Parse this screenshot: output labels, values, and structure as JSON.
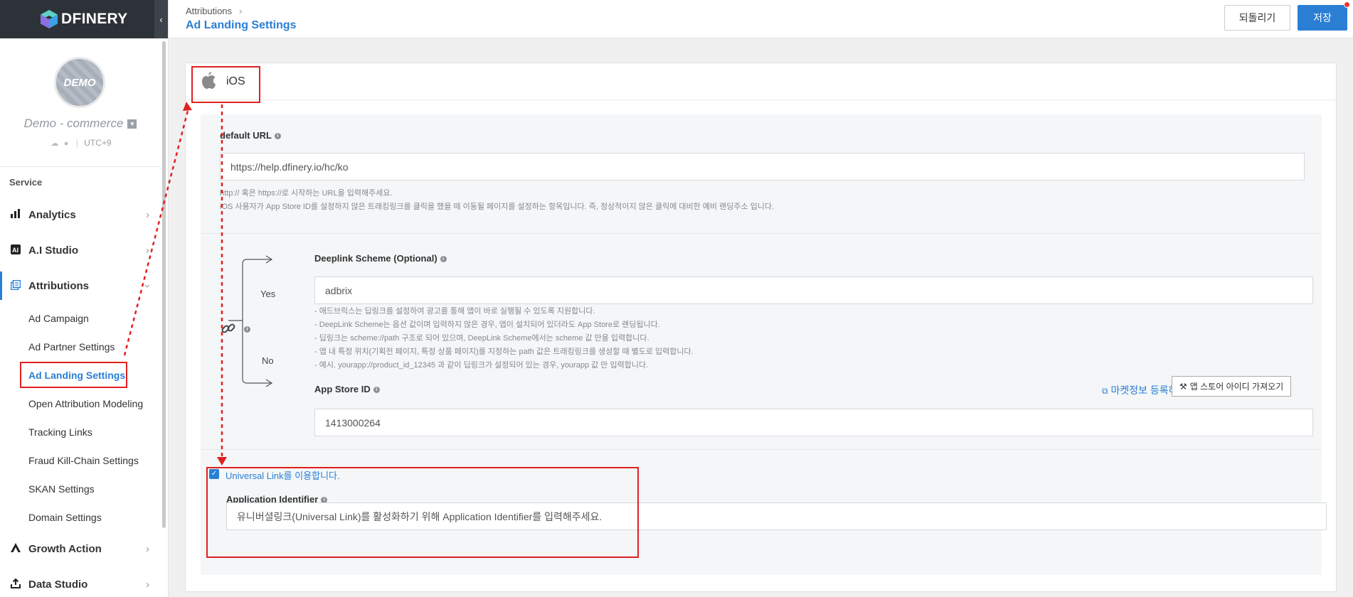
{
  "brand": {
    "name": "DFINERY"
  },
  "sidebar": {
    "collapse_icon": "‹",
    "profile": {
      "avatar_text": "DEMO",
      "company": "Demo - commerce",
      "timezone": "UTC+9"
    },
    "section_title": "Service",
    "items": [
      {
        "label": "Analytics",
        "icon": "bar-chart-icon"
      },
      {
        "label": "A.I Studio",
        "icon": "ai-icon"
      },
      {
        "label": "Attributions",
        "icon": "attributions-icon"
      },
      {
        "label": "Growth Action",
        "icon": "growth-icon"
      },
      {
        "label": "Data Studio",
        "icon": "data-studio-icon"
      }
    ],
    "sub_items": [
      {
        "label": "Ad Campaign"
      },
      {
        "label": "Ad Partner Settings"
      },
      {
        "label": "Ad Landing Settings"
      },
      {
        "label": "Open Attribution Modeling"
      },
      {
        "label": "Tracking Links"
      },
      {
        "label": "Fraud Kill-Chain Settings"
      },
      {
        "label": "SKAN Settings"
      },
      {
        "label": "Domain Settings"
      }
    ]
  },
  "header": {
    "breadcrumb": "Attributions",
    "title": "Ad Landing Settings",
    "revert_label": "되돌리기",
    "save_label": "저장"
  },
  "card": {
    "platform": "iOS",
    "default_url": {
      "label": "default URL",
      "value": "https://help.dfinery.io/hc/ko",
      "help_1": "http:// 혹은 https://로 시작하는 URL을 입력해주세요.",
      "help_2": "iOS 사용자가 App Store ID를 설정하지 않은 트래킹링크를 클릭을 했을 때 이동될 페이지를 설정하는 항목입니다. 즉, 정상적이지 않은 클릭에 대비한 예비 랜딩주소 입니다."
    },
    "branch": {
      "yes": "Yes",
      "no": "No"
    },
    "deeplink": {
      "label": "Deeplink Scheme (Optional)",
      "value": "adbrix",
      "notes": [
        "- 애드브릭스는 딥링크를 설정하여 광고를 통해 앱이 바로 실행될 수 있도록 지원합니다.",
        "- DeepLink Scheme는 옵션 값이며 입력하지 않은 경우, 앱이 설치되어 있더라도 App Store로 랜딩됩니다.",
        "- 딥링크는 scheme://path 구조로 되어 있으며, DeepLink Scheme에서는 scheme 값 만을 입력합니다.",
        "- 앱 내 특정 위치(기획전 페이지, 특정 상품 페이지)를 지정하는 path 값은 트래킹링크를 생성할 때 별도로 입력합니다.",
        "- 예시. yourapp://product_id_12345 과 같이 딥링크가 설정되어 있는 경우, yourapp 값 만 입력합니다."
      ]
    },
    "app_store": {
      "label": "App Store ID",
      "value": "1413000264",
      "market_link": "마켓정보 등록하기",
      "fetch_button": "앱 스토어 아이디 가져오기"
    },
    "universal_link": {
      "checkbox_label": "Universal Link를 이용합니다.",
      "checked": true,
      "identifier_label": "Application Identifier",
      "identifier_placeholder": "유니버셜링크(Universal Link)를 활성화하기 위해 Application Identifier를 입력해주세요."
    }
  },
  "colors": {
    "accent": "#2a7fd4",
    "annotation": "#e02020",
    "sidebar_dark": "#2c3238"
  }
}
